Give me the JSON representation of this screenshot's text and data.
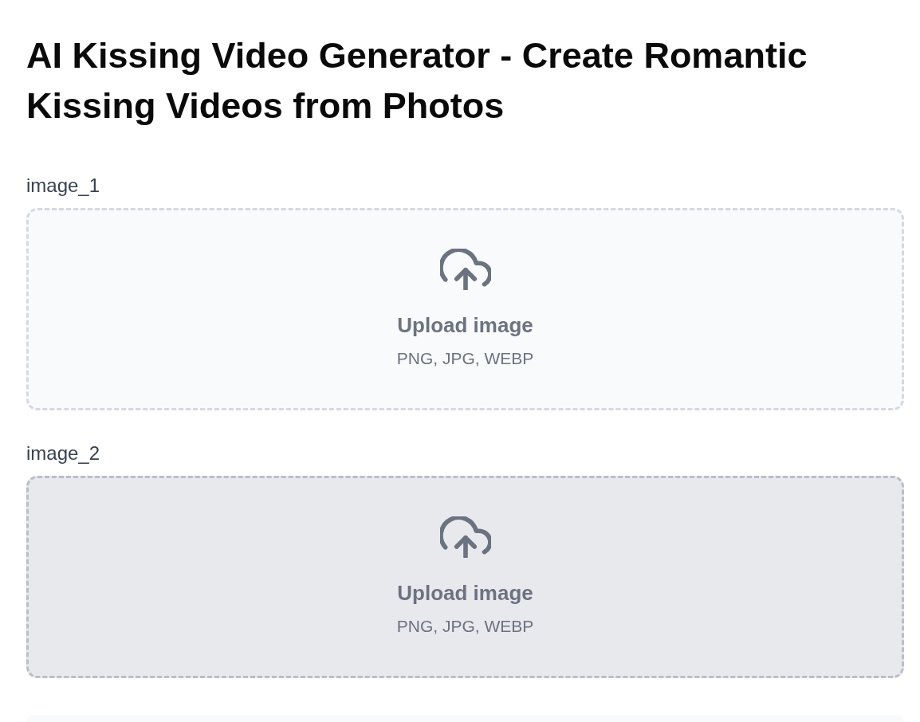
{
  "title": "AI Kissing Video Generator - Create Romantic Kissing Videos from Photos",
  "fields": [
    {
      "label": "image_1",
      "hovered": false,
      "upload": {
        "prompt": "Upload image",
        "formats": "PNG, JPG, WEBP"
      }
    },
    {
      "label": "image_2",
      "hovered": true,
      "upload": {
        "prompt": "Upload image",
        "formats": "PNG, JPG, WEBP"
      }
    }
  ]
}
